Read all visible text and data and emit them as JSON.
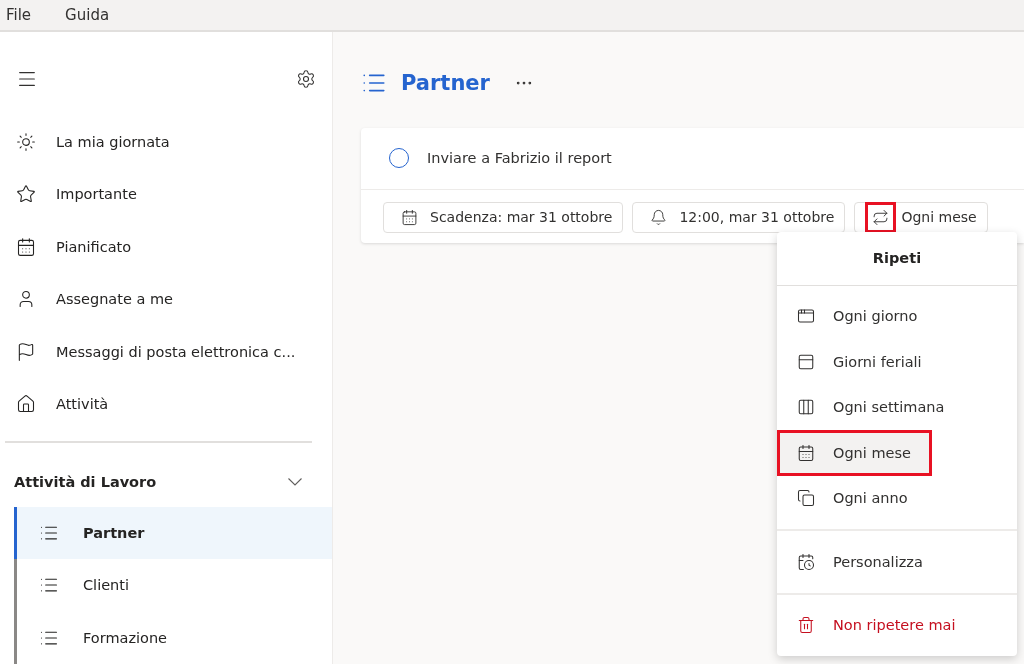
{
  "menubar": [
    "File",
    "Guida"
  ],
  "sidebar": {
    "items": [
      {
        "label": "La mia giornata",
        "selected": false
      },
      {
        "label": "Importante",
        "selected": false
      },
      {
        "label": "Pianificato",
        "selected": false
      },
      {
        "label": "Assegnate a me",
        "selected": false
      },
      {
        "label": "Messaggi di posta elettronica c...",
        "selected": false
      },
      {
        "label": "Attività",
        "selected": false
      }
    ],
    "group": {
      "label": "Attività di Lavoro",
      "expanded": true,
      "lists": [
        {
          "label": "Partner",
          "selected": true
        },
        {
          "label": "Clienti",
          "selected": false
        },
        {
          "label": "Formazione",
          "selected": false
        }
      ]
    }
  },
  "list_title": "Partner",
  "task": {
    "title": "Inviare a Fabrizio il report",
    "completed": false,
    "chips": [
      {
        "kind": "due",
        "label": "Scadenza: mar 31 ottobre"
      },
      {
        "kind": "reminder",
        "label": "12:00, mar 31 ottobre"
      },
      {
        "kind": "repeat",
        "label": "Ogni mese",
        "highlighted": true
      }
    ]
  },
  "repeat_menu": {
    "title": "Ripeti",
    "sections": [
      [
        {
          "label": "Ogni giorno",
          "kind": "option",
          "selected": false,
          "highlighted": false
        },
        {
          "label": "Giorni feriali",
          "kind": "option",
          "selected": false,
          "highlighted": false
        },
        {
          "label": "Ogni settimana",
          "kind": "option",
          "selected": false,
          "highlighted": false
        },
        {
          "label": "Ogni mese",
          "kind": "option",
          "selected": true,
          "highlighted": true
        },
        {
          "label": "Ogni anno",
          "kind": "option",
          "selected": false,
          "highlighted": false
        }
      ],
      [
        {
          "label": "Personalizza",
          "kind": "option",
          "selected": false,
          "highlighted": false
        }
      ],
      [
        {
          "label": "Non ripetere mai",
          "kind": "danger",
          "selected": false,
          "highlighted": false
        }
      ]
    ]
  }
}
